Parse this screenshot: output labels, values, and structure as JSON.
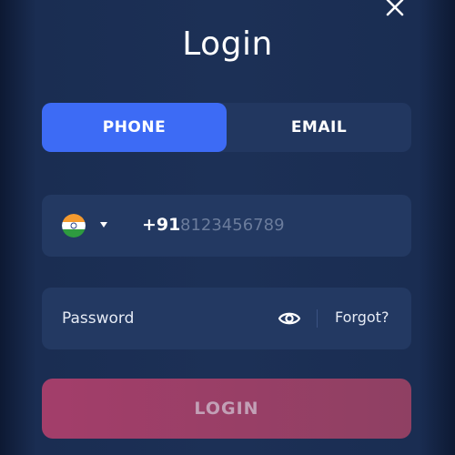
{
  "header": {
    "title": "Login",
    "close_icon": "close-icon"
  },
  "tabs": [
    {
      "label": "PHONE",
      "active": true
    },
    {
      "label": "EMAIL",
      "active": false
    }
  ],
  "phone": {
    "flag_icon": "india-flag-icon",
    "dropdown_icon": "caret-down-icon",
    "country_code": "+91",
    "placeholder": "8123456789",
    "value": ""
  },
  "password": {
    "placeholder": "Password",
    "value": "",
    "eye_icon": "eye-icon",
    "forgot_label": "Forgot?"
  },
  "login_button": {
    "label": "LOGIN",
    "enabled": false
  },
  "colors": {
    "background": "#1c3056",
    "field": "#233962",
    "tab_active": "#3d6bf5",
    "login_gradient_start": "#a33e6a",
    "login_gradient_end": "#8f4063"
  }
}
